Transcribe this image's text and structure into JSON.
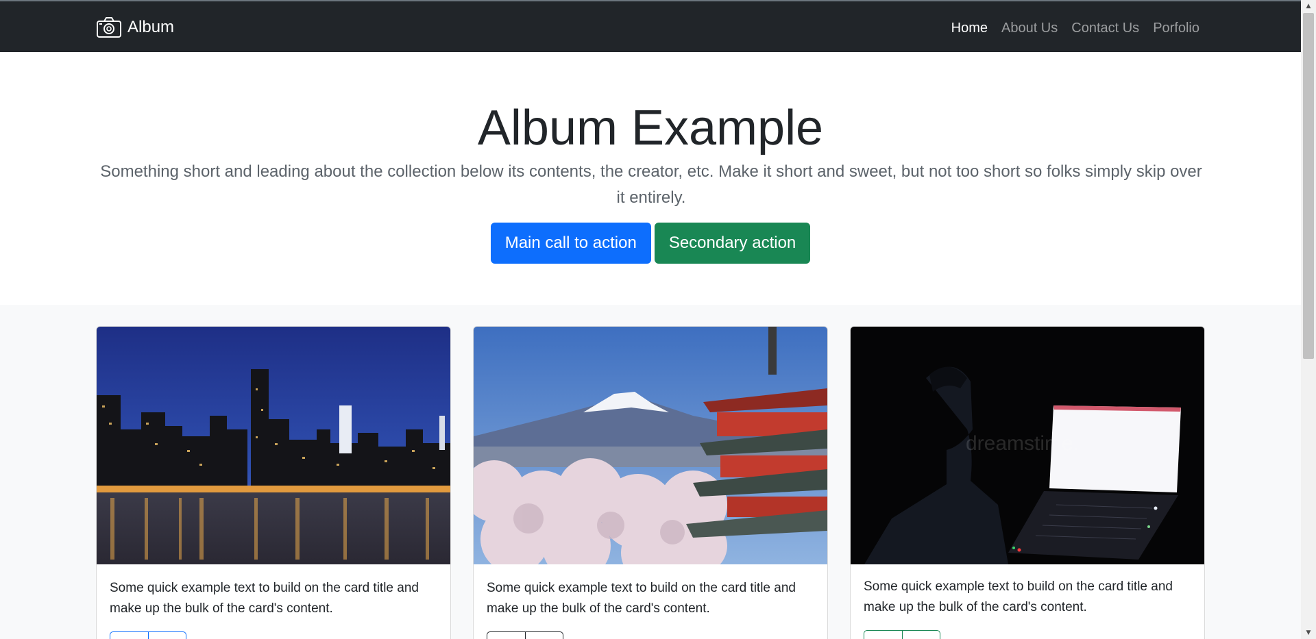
{
  "navbar": {
    "brand": "Album",
    "brand_icon": "camera-icon",
    "links": [
      {
        "label": "Home",
        "active": true
      },
      {
        "label": "About Us",
        "active": false
      },
      {
        "label": "Contact Us",
        "active": false
      },
      {
        "label": "Porfolio",
        "active": false
      }
    ]
  },
  "hero": {
    "title": "Album Example",
    "lead": "Something short and leading about the collection below its contents, the creator, etc. Make it short and sweet, but not too short so folks simply skip over it entirely.",
    "primary_action": "Main call to action",
    "secondary_action": "Secondary action"
  },
  "cards": [
    {
      "text": "Some quick example text to build on the card title and make up the bulk of the card's content.",
      "image": "city-skyline-at-night"
    },
    {
      "text": "Some quick example text to build on the card title and make up the bulk of the card's content.",
      "image": "mount-fuji-pagoda-cherry-blossoms"
    },
    {
      "text": "Some quick example text to build on the card title and make up the bulk of the card's content.",
      "image": "person-at-laptop-in-dark",
      "watermark": "dreamstime."
    }
  ],
  "colors": {
    "navbar_bg": "#212529",
    "primary": "#0d6efd",
    "success": "#198754",
    "album_bg": "#f8f9fa"
  }
}
